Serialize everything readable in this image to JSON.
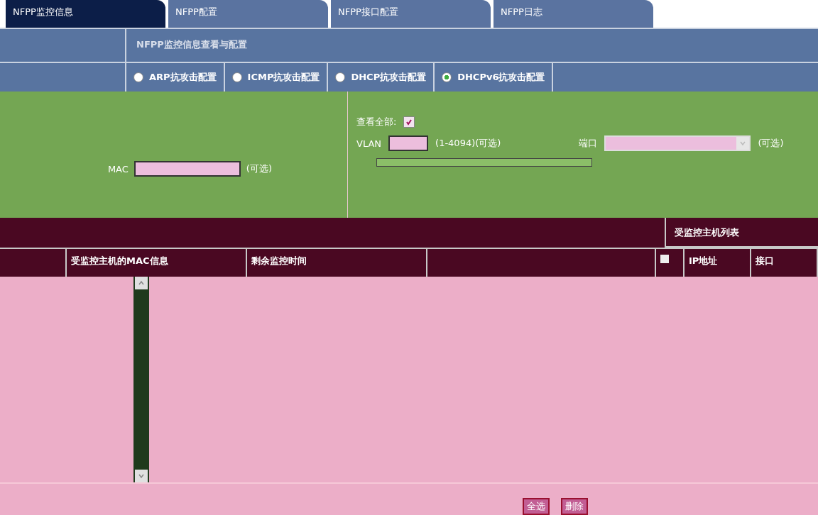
{
  "tabs": [
    {
      "label": "NFPP监控信息",
      "selected": true
    },
    {
      "label": "NFPP配置",
      "selected": false
    },
    {
      "label": "NFPP接口配置",
      "selected": false
    },
    {
      "label": "NFPP日志",
      "selected": false
    }
  ],
  "section_title": "NFPP监控信息查看与配置",
  "guard_options": [
    {
      "label": "ARP抗攻击配置",
      "selected": false
    },
    {
      "label": "ICMP抗攻击配置",
      "selected": false
    },
    {
      "label": "DHCP抗攻击配置",
      "selected": false
    },
    {
      "label": "DHCPv6抗攻击配置",
      "selected": true
    }
  ],
  "filter": {
    "mac_label": "MAC",
    "mac_hint": "(可选)",
    "view_all_label": "查看全部:",
    "view_all_checked": true,
    "vlan_label": "VLAN",
    "vlan_hint": "(1-4094)(可选)",
    "port_label": "端口",
    "port_hint": "(可选)"
  },
  "monitored_table": {
    "title": "受监控主机列表",
    "columns": [
      "受监控主机的MAC信息",
      "剩余监控时间"
    ],
    "select_all_checked": false,
    "side_columns": [
      "IP地址",
      "接口"
    ]
  },
  "buttons": [
    "全选",
    "删除"
  ]
}
